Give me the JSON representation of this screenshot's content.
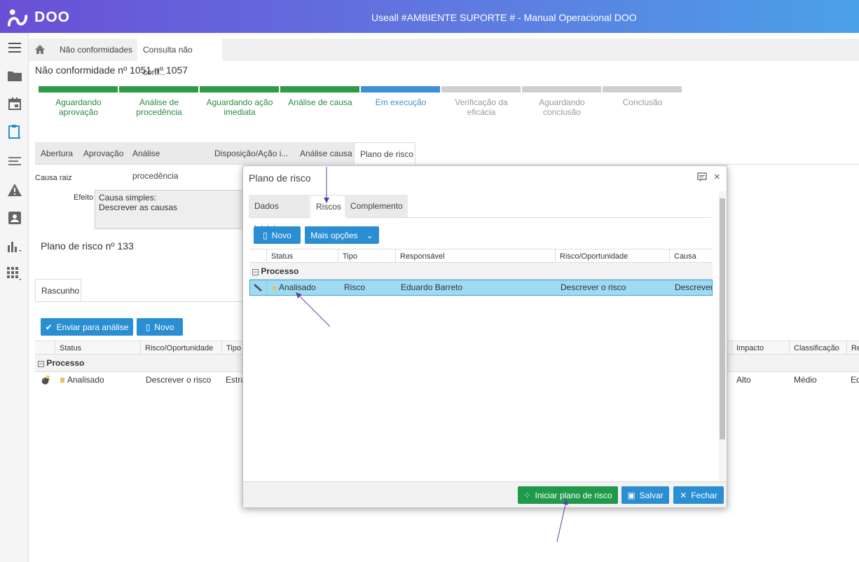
{
  "app": {
    "logo_text": "DOO",
    "window_title": "Useall #AMBIENTE SUPORTE # - Manual Operacional DOO"
  },
  "breadcrumb": {
    "item1": "Não conformidades",
    "item2": "Consulta não conf..."
  },
  "page_title": "Não conformidade nº 1051 nº 1057",
  "steps": [
    {
      "label_line1": "Aguardando",
      "label_line2": "aprovação",
      "state": "done"
    },
    {
      "label_line1": "Análise de",
      "label_line2": "procedência",
      "state": "done"
    },
    {
      "label_line1": "Aguardando ação",
      "label_line2": "imediata",
      "state": "done"
    },
    {
      "label_line1": "Análise de causa",
      "label_line2": "",
      "state": "done"
    },
    {
      "label_line1": "Em execução",
      "label_line2": "",
      "state": "current"
    },
    {
      "label_line1": "Verificação da eficácia",
      "label_line2": "",
      "state": "pending"
    },
    {
      "label_line1": "Aguardando",
      "label_line2": "conclusão",
      "state": "pending"
    },
    {
      "label_line1": "Conclusão",
      "label_line2": "",
      "state": "pending"
    }
  ],
  "colors": {
    "done": "#2e9b47",
    "current": "#3d8fd6",
    "pending": "#cfcfcf",
    "done_text": "#2a8a3e",
    "current_text": "#3d8fd6",
    "pending_text": "#999999"
  },
  "tabs": [
    "Abertura",
    "Aprovação",
    "Análise procedência",
    "Disposição/Ação i...",
    "Análise causa",
    "Plano de risco"
  ],
  "causa": {
    "section": "Causa raiz",
    "efeito_label": "Efeito",
    "efeito_line1": "Causa simples:",
    "efeito_line2": "Descrever as causas"
  },
  "plano": {
    "title": "Plano de risco nº 133",
    "status_tab": "Rascunho",
    "btn_enviar": "Enviar para análise",
    "btn_novo": "Novo"
  },
  "bg_grid": {
    "headers": [
      "Status",
      "Risco/Oportunidade",
      "Tipo"
    ],
    "right_headers": [
      "Impacto",
      "Classificação",
      "Re"
    ],
    "group": "Processo",
    "row": {
      "status": "Analisado",
      "risco": "Descrever o risco",
      "tipo": "Estra",
      "impacto": "Alto",
      "classificacao": "Médio",
      "extra": "Ed"
    }
  },
  "modal": {
    "title": "Plano de risco",
    "tabs": [
      "Dados iniciais",
      "Riscos",
      "Complemento"
    ],
    "btn_novo": "Novo",
    "btn_mais": "Mais opções",
    "headers": [
      "Status",
      "Tipo",
      "Responsável",
      "Risco/Oportunidade",
      "Causa"
    ],
    "group": "Processo",
    "row": {
      "status": "Analisado",
      "tipo": "Risco",
      "responsavel": "Eduardo Barreto",
      "risco": "Descrever o risco",
      "causa": "Descrever a"
    },
    "btn_iniciar": "Iniciar plano de risco",
    "btn_salvar": "Salvar",
    "btn_fechar": "Fechar"
  }
}
